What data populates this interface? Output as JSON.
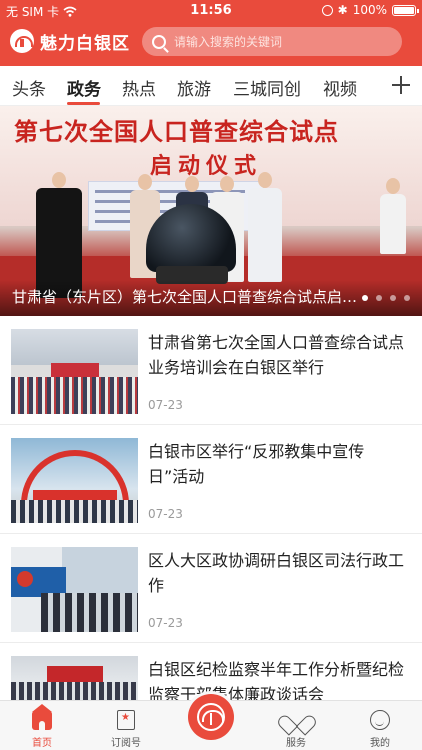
{
  "status_bar": {
    "carrier": "无 SIM 卡",
    "time": "11:56",
    "battery": "100%"
  },
  "header": {
    "app_title": "魅力白银区",
    "search_placeholder": "请输入搜索的关键词"
  },
  "tabs": [
    {
      "label": "头条"
    },
    {
      "label": "政务"
    },
    {
      "label": "热点"
    },
    {
      "label": "旅游"
    },
    {
      "label": "三城同创"
    },
    {
      "label": "视频"
    }
  ],
  "active_tab": "政务",
  "banner": {
    "photo_text_line1": "第七次全国人口普查综合试点",
    "photo_text_line2": "启动仪式",
    "caption": "甘肃省（东片区）第七次全国人口普查综合试点启动仪式",
    "slide_count": 4,
    "active_slide": 1
  },
  "news": [
    {
      "title": "甘肃省第七次全国人口普查综合试点业务培训会在白银区举行",
      "date": "07-23"
    },
    {
      "title": "白银市区举行“反邪教集中宣传日”活动",
      "date": "07-23"
    },
    {
      "title": "区人大区政协调研白银区司法行政工作",
      "date": "07-23"
    },
    {
      "title": "白银区纪检监察半年工作分析暨纪检监察干部集体廉政谈话会",
      "date": ""
    }
  ],
  "bottom_nav": [
    {
      "label": "首页"
    },
    {
      "label": "订阅号"
    },
    {
      "label": ""
    },
    {
      "label": "服务"
    },
    {
      "label": "我的"
    }
  ],
  "colors": {
    "brand_red": "#e94b3c",
    "text_dark": "#222222",
    "text_muted": "#9a9a9a"
  }
}
